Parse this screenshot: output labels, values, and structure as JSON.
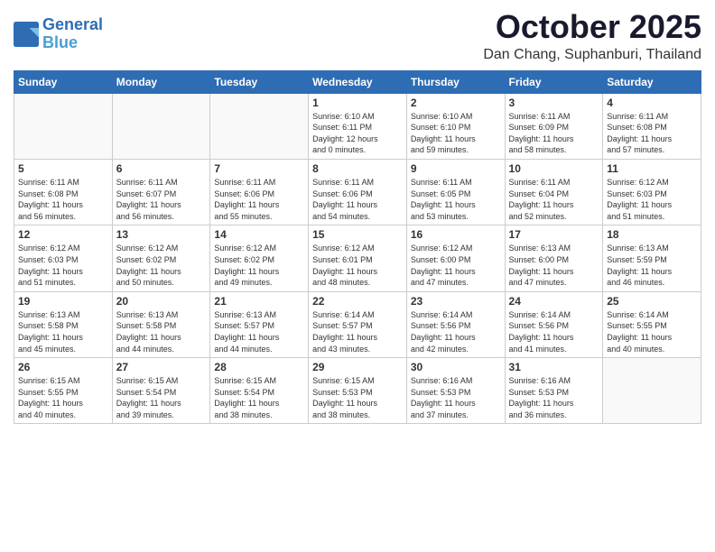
{
  "header": {
    "logo_line1": "General",
    "logo_line2": "Blue",
    "month": "October 2025",
    "location": "Dan Chang, Suphanburi, Thailand"
  },
  "weekdays": [
    "Sunday",
    "Monday",
    "Tuesday",
    "Wednesday",
    "Thursday",
    "Friday",
    "Saturday"
  ],
  "weeks": [
    [
      {
        "day": "",
        "info": ""
      },
      {
        "day": "",
        "info": ""
      },
      {
        "day": "",
        "info": ""
      },
      {
        "day": "1",
        "info": "Sunrise: 6:10 AM\nSunset: 6:11 PM\nDaylight: 12 hours\nand 0 minutes."
      },
      {
        "day": "2",
        "info": "Sunrise: 6:10 AM\nSunset: 6:10 PM\nDaylight: 11 hours\nand 59 minutes."
      },
      {
        "day": "3",
        "info": "Sunrise: 6:11 AM\nSunset: 6:09 PM\nDaylight: 11 hours\nand 58 minutes."
      },
      {
        "day": "4",
        "info": "Sunrise: 6:11 AM\nSunset: 6:08 PM\nDaylight: 11 hours\nand 57 minutes."
      }
    ],
    [
      {
        "day": "5",
        "info": "Sunrise: 6:11 AM\nSunset: 6:08 PM\nDaylight: 11 hours\nand 56 minutes."
      },
      {
        "day": "6",
        "info": "Sunrise: 6:11 AM\nSunset: 6:07 PM\nDaylight: 11 hours\nand 56 minutes."
      },
      {
        "day": "7",
        "info": "Sunrise: 6:11 AM\nSunset: 6:06 PM\nDaylight: 11 hours\nand 55 minutes."
      },
      {
        "day": "8",
        "info": "Sunrise: 6:11 AM\nSunset: 6:06 PM\nDaylight: 11 hours\nand 54 minutes."
      },
      {
        "day": "9",
        "info": "Sunrise: 6:11 AM\nSunset: 6:05 PM\nDaylight: 11 hours\nand 53 minutes."
      },
      {
        "day": "10",
        "info": "Sunrise: 6:11 AM\nSunset: 6:04 PM\nDaylight: 11 hours\nand 52 minutes."
      },
      {
        "day": "11",
        "info": "Sunrise: 6:12 AM\nSunset: 6:03 PM\nDaylight: 11 hours\nand 51 minutes."
      }
    ],
    [
      {
        "day": "12",
        "info": "Sunrise: 6:12 AM\nSunset: 6:03 PM\nDaylight: 11 hours\nand 51 minutes."
      },
      {
        "day": "13",
        "info": "Sunrise: 6:12 AM\nSunset: 6:02 PM\nDaylight: 11 hours\nand 50 minutes."
      },
      {
        "day": "14",
        "info": "Sunrise: 6:12 AM\nSunset: 6:02 PM\nDaylight: 11 hours\nand 49 minutes."
      },
      {
        "day": "15",
        "info": "Sunrise: 6:12 AM\nSunset: 6:01 PM\nDaylight: 11 hours\nand 48 minutes."
      },
      {
        "day": "16",
        "info": "Sunrise: 6:12 AM\nSunset: 6:00 PM\nDaylight: 11 hours\nand 47 minutes."
      },
      {
        "day": "17",
        "info": "Sunrise: 6:13 AM\nSunset: 6:00 PM\nDaylight: 11 hours\nand 47 minutes."
      },
      {
        "day": "18",
        "info": "Sunrise: 6:13 AM\nSunset: 5:59 PM\nDaylight: 11 hours\nand 46 minutes."
      }
    ],
    [
      {
        "day": "19",
        "info": "Sunrise: 6:13 AM\nSunset: 5:58 PM\nDaylight: 11 hours\nand 45 minutes."
      },
      {
        "day": "20",
        "info": "Sunrise: 6:13 AM\nSunset: 5:58 PM\nDaylight: 11 hours\nand 44 minutes."
      },
      {
        "day": "21",
        "info": "Sunrise: 6:13 AM\nSunset: 5:57 PM\nDaylight: 11 hours\nand 44 minutes."
      },
      {
        "day": "22",
        "info": "Sunrise: 6:14 AM\nSunset: 5:57 PM\nDaylight: 11 hours\nand 43 minutes."
      },
      {
        "day": "23",
        "info": "Sunrise: 6:14 AM\nSunset: 5:56 PM\nDaylight: 11 hours\nand 42 minutes."
      },
      {
        "day": "24",
        "info": "Sunrise: 6:14 AM\nSunset: 5:56 PM\nDaylight: 11 hours\nand 41 minutes."
      },
      {
        "day": "25",
        "info": "Sunrise: 6:14 AM\nSunset: 5:55 PM\nDaylight: 11 hours\nand 40 minutes."
      }
    ],
    [
      {
        "day": "26",
        "info": "Sunrise: 6:15 AM\nSunset: 5:55 PM\nDaylight: 11 hours\nand 40 minutes."
      },
      {
        "day": "27",
        "info": "Sunrise: 6:15 AM\nSunset: 5:54 PM\nDaylight: 11 hours\nand 39 minutes."
      },
      {
        "day": "28",
        "info": "Sunrise: 6:15 AM\nSunset: 5:54 PM\nDaylight: 11 hours\nand 38 minutes."
      },
      {
        "day": "29",
        "info": "Sunrise: 6:15 AM\nSunset: 5:53 PM\nDaylight: 11 hours\nand 38 minutes."
      },
      {
        "day": "30",
        "info": "Sunrise: 6:16 AM\nSunset: 5:53 PM\nDaylight: 11 hours\nand 37 minutes."
      },
      {
        "day": "31",
        "info": "Sunrise: 6:16 AM\nSunset: 5:53 PM\nDaylight: 11 hours\nand 36 minutes."
      },
      {
        "day": "",
        "info": ""
      }
    ]
  ]
}
